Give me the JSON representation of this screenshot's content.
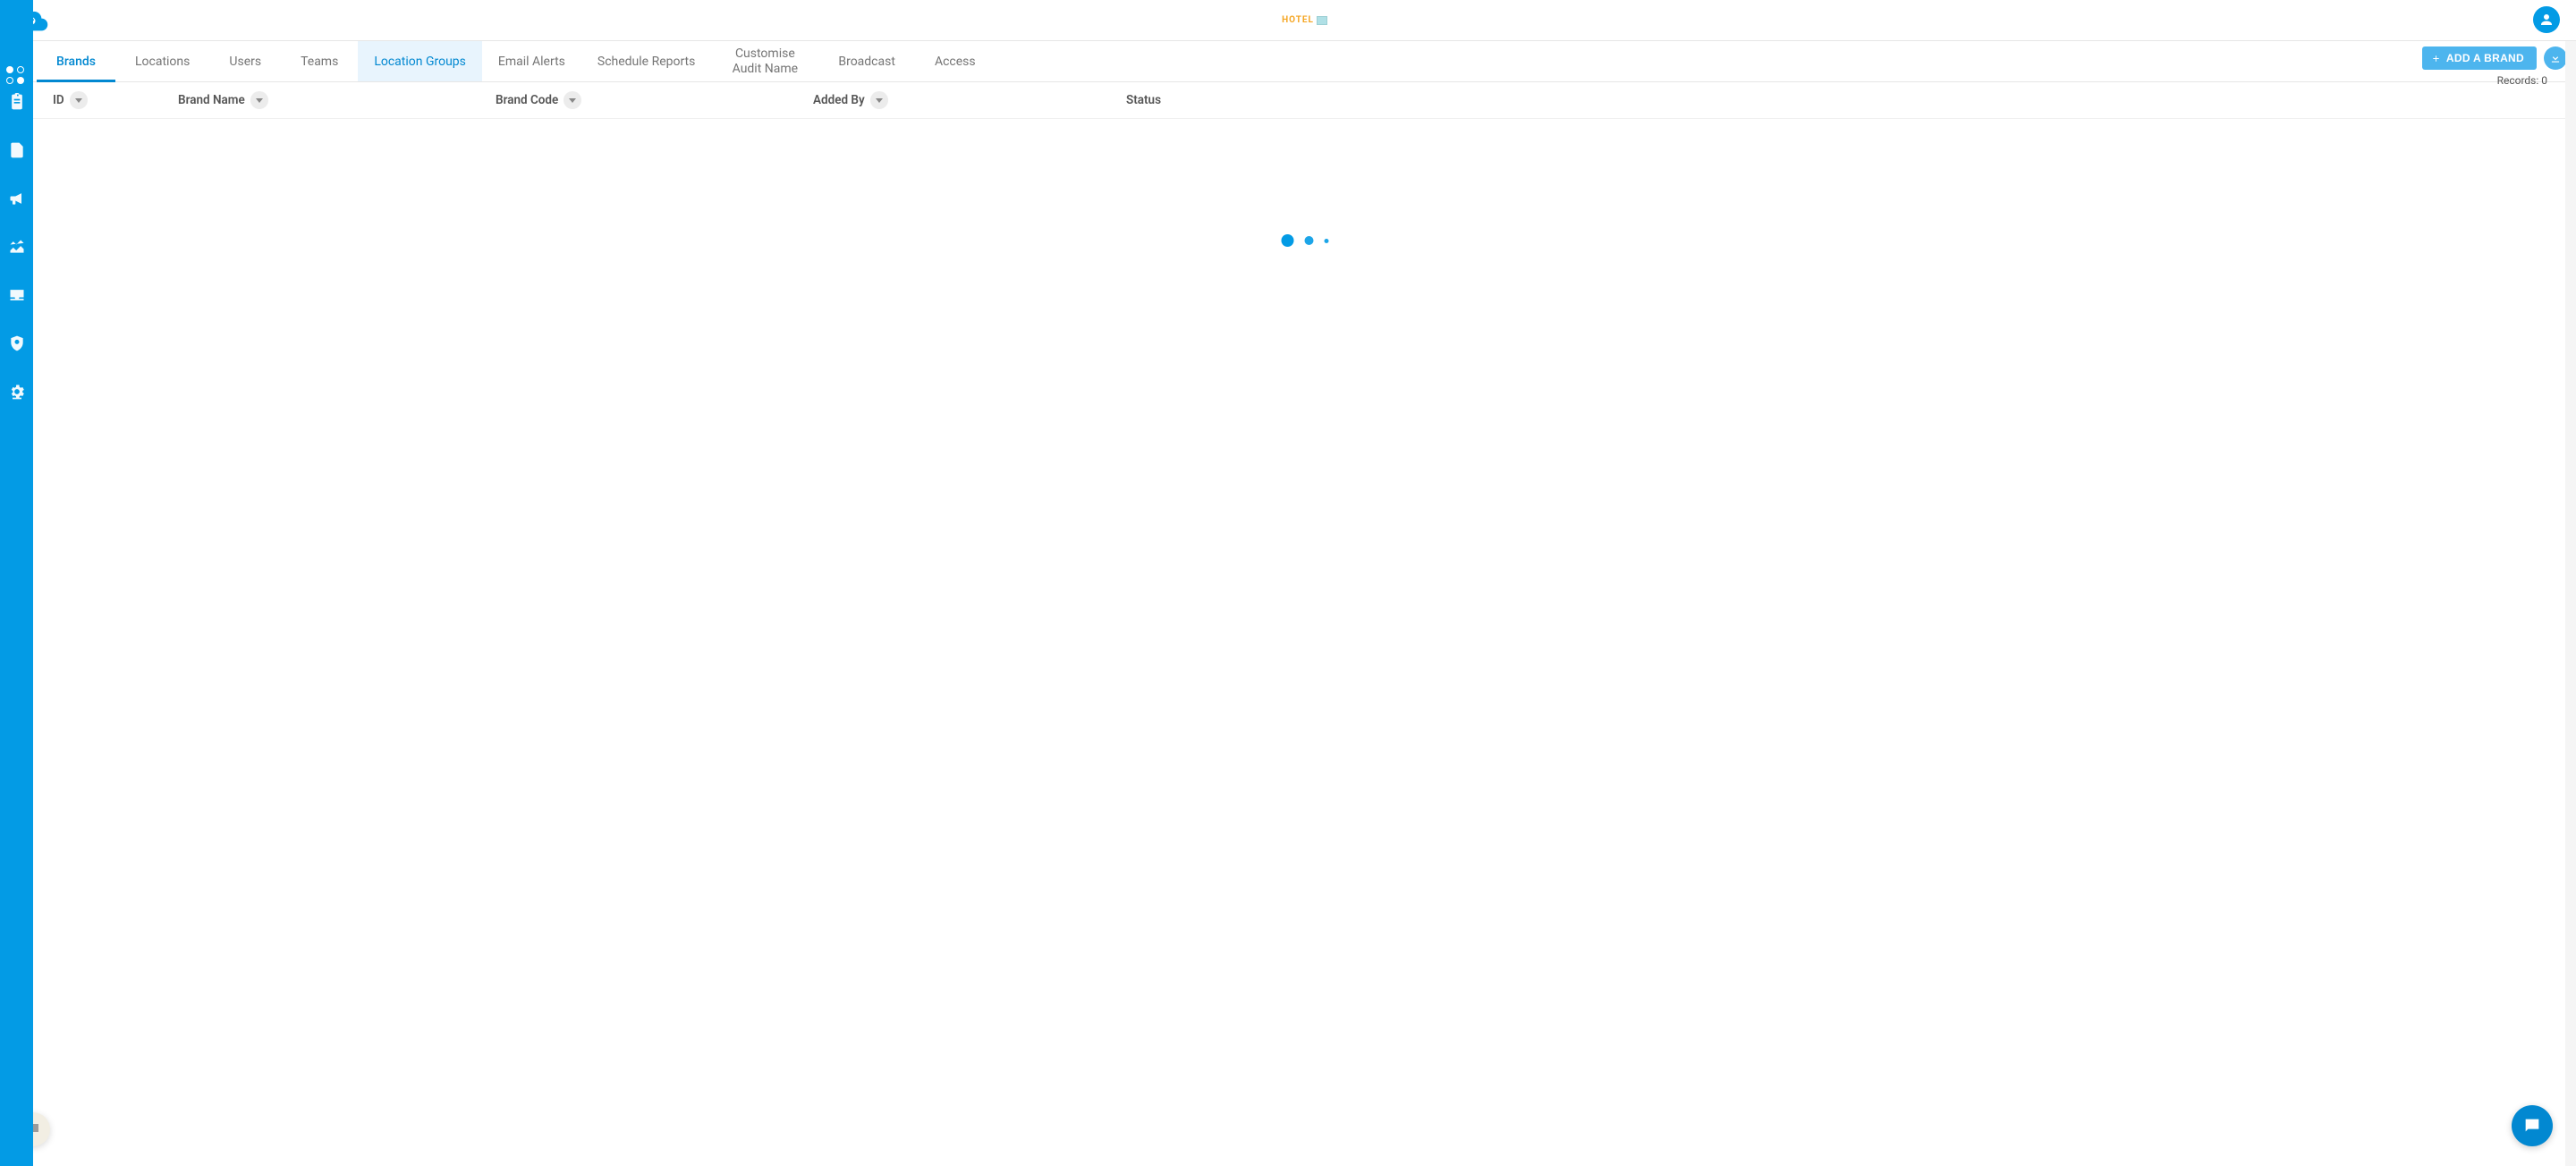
{
  "colors": {
    "primary": "#039be5",
    "accent": "#0288d1",
    "button": "#4db5ee"
  },
  "header": {
    "brand_text": "HOTEL"
  },
  "subnav": {
    "tabs": {
      "brands": "Brands",
      "locations": "Locations",
      "users": "Users",
      "teams": "Teams",
      "location_groups": "Location Groups",
      "email_alerts": "Email Alerts",
      "schedule_reports": "Schedule Reports",
      "customise_audit_name": "Customise Audit Name",
      "broadcast": "Broadcast",
      "access": "Access"
    },
    "add_button_label": "ADD A BRAND",
    "records_label": "Records: 0"
  },
  "table": {
    "columns": {
      "id": "ID",
      "brand_name": "Brand Name",
      "brand_code": "Brand Code",
      "added_by": "Added By",
      "status": "Status"
    },
    "rows": []
  },
  "sidebar": {
    "icons": [
      "clipboard-icon",
      "document-icon",
      "megaphone-icon",
      "chart-icon",
      "inbox-icon",
      "shield-icon",
      "settings-icon"
    ]
  }
}
